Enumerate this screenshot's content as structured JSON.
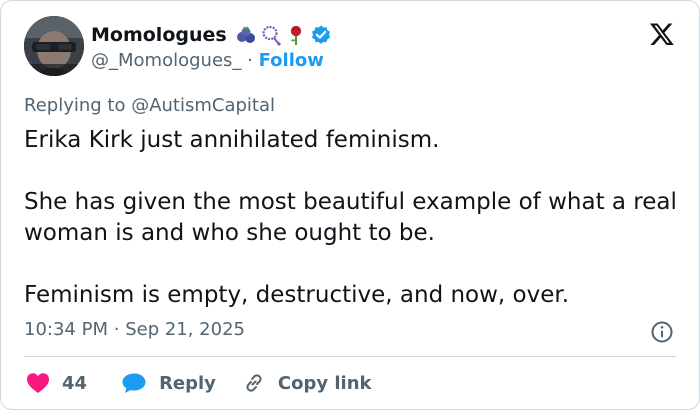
{
  "tweet": {
    "author": {
      "display_name": "Momologues",
      "emojis": [
        "blueberries-emoji",
        "prayer-beads-emoji",
        "rose-emoji"
      ],
      "verified": true,
      "handle": "@_Momologues_",
      "separator": "·",
      "follow_label": "Follow"
    },
    "reply_to": {
      "prefix": "Replying to ",
      "mention": "@AutismCapital"
    },
    "text": "Erika Kirk just annihilated feminism.\n\nShe has given the most beautiful example of what a real woman is and who she ought to be.\n\nFeminism is empty, destructive, and now, over.",
    "timestamp": {
      "time": "10:34 PM",
      "separator": "·",
      "date": "Sep 21, 2025"
    },
    "actions": {
      "like_count": "44",
      "reply_label": "Reply",
      "copy_link_label": "Copy link"
    }
  },
  "colors": {
    "link_blue": "#1d9bf0",
    "like_red": "#f91880",
    "muted_gray": "#536471",
    "text_dark": "#0f1419",
    "border": "#cfd9de"
  },
  "icons": {
    "brand": "x-logo-icon",
    "verified": "verified-badge-icon",
    "info": "info-icon",
    "like": "heart-icon",
    "reply": "speech-bubble-icon",
    "copy": "link-icon"
  }
}
